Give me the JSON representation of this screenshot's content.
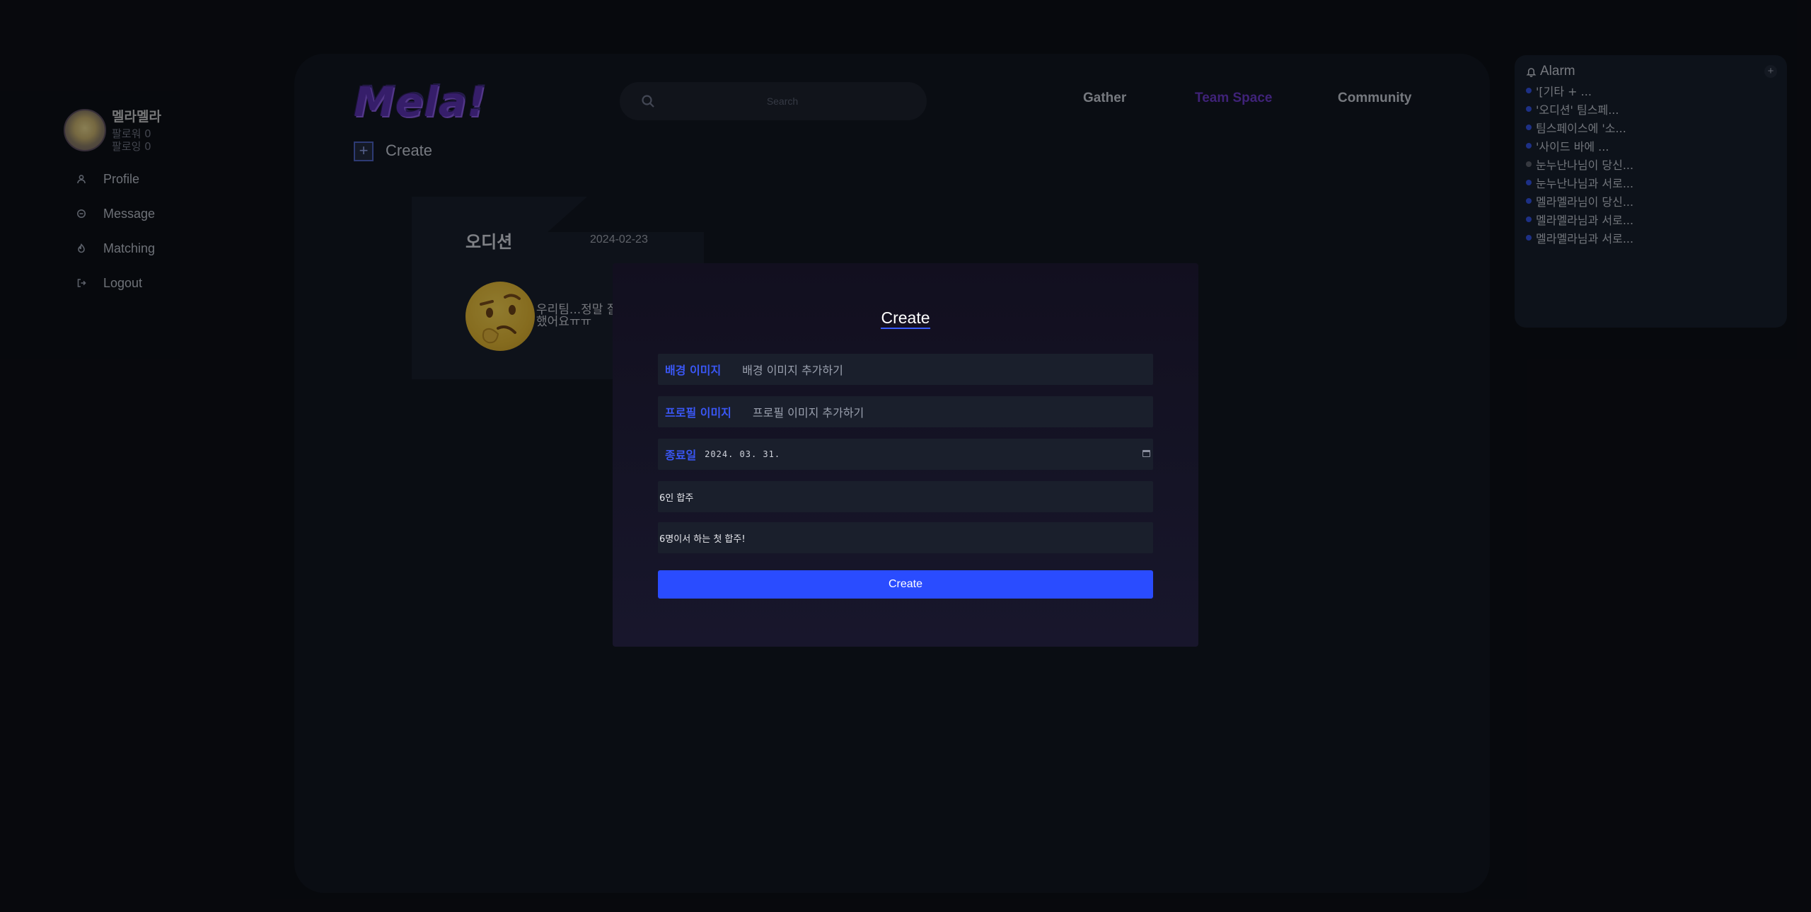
{
  "profile": {
    "name": "멜라멜라",
    "followers": "팔로워 0",
    "following": "팔로잉 0"
  },
  "sidebar": {
    "items": [
      {
        "label": "Profile",
        "icon": "user-icon"
      },
      {
        "label": "Message",
        "icon": "chat-bubble-icon"
      },
      {
        "label": "Matching",
        "icon": "flame-icon"
      },
      {
        "label": "Logout",
        "icon": "logout-icon"
      }
    ]
  },
  "header": {
    "logo": "Mela!",
    "search_placeholder": "Search",
    "nav": [
      {
        "label": "Gather",
        "active": false
      },
      {
        "label": "Team Space",
        "active": true
      },
      {
        "label": "Community",
        "active": false
      }
    ],
    "active_color": "#6a36c9"
  },
  "toolbar": {
    "create_icon": "+",
    "create_label": "Create"
  },
  "card": {
    "title": "오디션",
    "date": "2024-02-23",
    "text_line1": "우리팀...정말 잘",
    "text_line2": "했어요ㅠㅠ"
  },
  "modal": {
    "title": "Create",
    "bg_image_label": "배경 이미지",
    "bg_image_value": "배경 이미지 추가하기",
    "profile_image_label": "프로필 이미지",
    "profile_image_value": "프로필 이미지 추가하기",
    "end_date_label": "종료일",
    "end_date_value": "2024. 03. 31.",
    "name_value": "6인 합주",
    "desc_value": "6명이서 하는 첫 합주!",
    "submit_label": "Create",
    "accent": "#2a4cff"
  },
  "alarm": {
    "title": "Alarm",
    "add_label": "+",
    "items": [
      {
        "text": "'[기타 + ...",
        "read": false
      },
      {
        "text": "'오디션' 팀스페...",
        "read": false
      },
      {
        "text": "팀스페이스에 '소...",
        "read": false
      },
      {
        "text": "'사이드 바에 ...",
        "read": false
      },
      {
        "text": "눈누난나님이 당신...",
        "read": true
      },
      {
        "text": "눈누난나님과 서로...",
        "read": false
      },
      {
        "text": "멜라멜라님이 당신...",
        "read": false
      },
      {
        "text": "멜라멜라님과 서로...",
        "read": false
      },
      {
        "text": "멜라멜라님과 서로...",
        "read": false
      }
    ],
    "unread_color": "#2f4fe0",
    "read_color": "#5a5e68"
  }
}
